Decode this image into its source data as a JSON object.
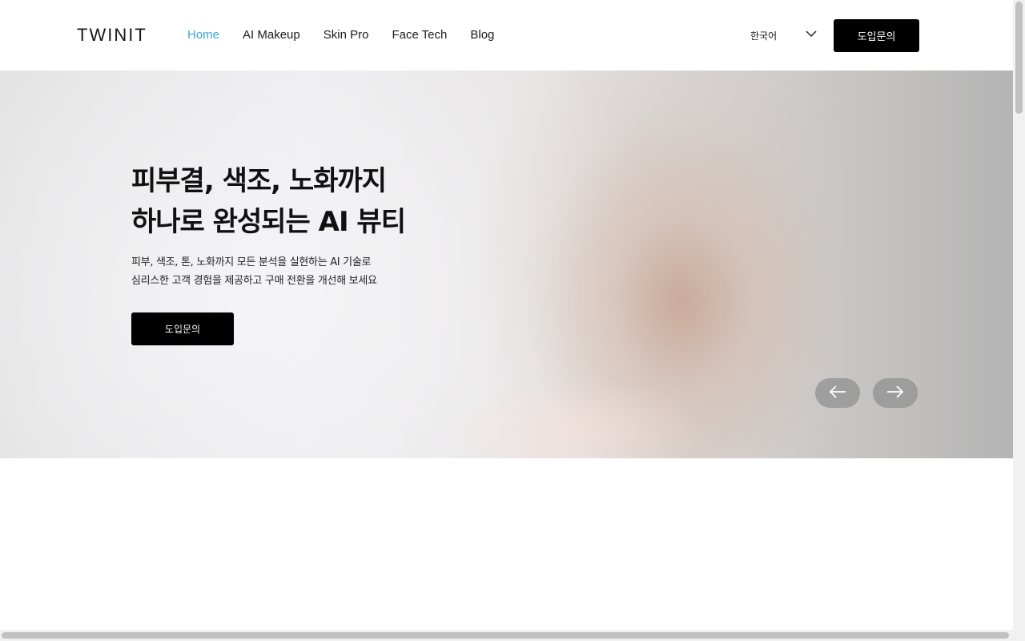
{
  "header": {
    "logo": "TWINIT",
    "nav": [
      {
        "label": "Home",
        "active": true
      },
      {
        "label": "AI Makeup",
        "active": false
      },
      {
        "label": "Skin Pro",
        "active": false
      },
      {
        "label": "Face Tech",
        "active": false
      },
      {
        "label": "Blog",
        "active": false
      }
    ],
    "language": {
      "selected": "한국어",
      "icon": "chevron-down-icon"
    },
    "cta_label": "도입문의"
  },
  "hero": {
    "title_lines": [
      "피부결, 색조, 노화까지",
      "하나로 완성되는 AI 뷰티"
    ],
    "subtitle_lines": [
      "피부, 색조, 톤, 노화까지 모든 분석을 실현하는 AI 기술로",
      "심리스한 고객 경험을 제공하고 구매 전환을 개선해 보세요"
    ],
    "cta_label": "도입문의",
    "prev_icon": "arrow-left-icon",
    "next_icon": "arrow-right-icon"
  },
  "colors": {
    "accent": "#3aa7d8",
    "button_bg": "#000000",
    "button_text": "#ffffff",
    "text": "#1a1a1a",
    "arrow_bg": "#969696"
  }
}
